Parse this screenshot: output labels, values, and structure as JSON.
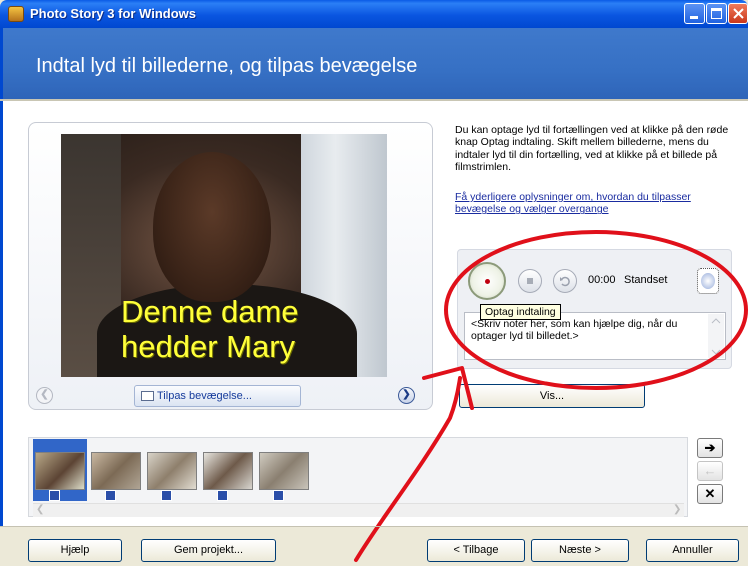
{
  "window": {
    "title": "Photo Story 3 for Windows",
    "controls": [
      "minimize-icon",
      "maximize-icon",
      "close-icon"
    ]
  },
  "header": {
    "title": "Indtal lyd til billederne, og tilpas bevægelse"
  },
  "preview": {
    "caption_line1": "Denne dame",
    "caption_line2": "hedder Mary",
    "customize_button": "Tilpas bevægelse...",
    "prev_icon": "chevron-left-icon",
    "next_icon": "chevron-right-icon"
  },
  "instructions": {
    "description": "Du kan optage lyd til fortællingen ved at klikke på den røde knap Optag indtaling. Skift mellem billederne, mens du indtaler lyd til din fortælling, ved at klikke på et billede på filmstrimlen.",
    "more_info_link": "Få yderligere oplysninger om, hvordan du tilpasser bevægelse og vælger overgange"
  },
  "recorder": {
    "timer": "00:00",
    "status": "Standset",
    "tooltip": "Optag indtaling",
    "notes_text": "<Skriv noter her, som kan hjælpe dig, når du optager lyd til billedet.>",
    "preview_button": "Vis..."
  },
  "filmstrip": {
    "thumbnail_count": 5,
    "selected_index": 0,
    "side_buttons": [
      "arrow-right-icon",
      "arrow-left-icon",
      "delete-icon"
    ]
  },
  "footer": {
    "help_button": "Hjælp",
    "save_button": "Gem projekt...",
    "back_button": "< Tilbage",
    "next_button": "Næste >",
    "cancel_button": "Annuller"
  },
  "colors": {
    "header_blue": "#3670c4",
    "caption_yellow": "#ffff3a",
    "annotation_red": "#e0101a",
    "link_blue": "#1a2ca0"
  }
}
